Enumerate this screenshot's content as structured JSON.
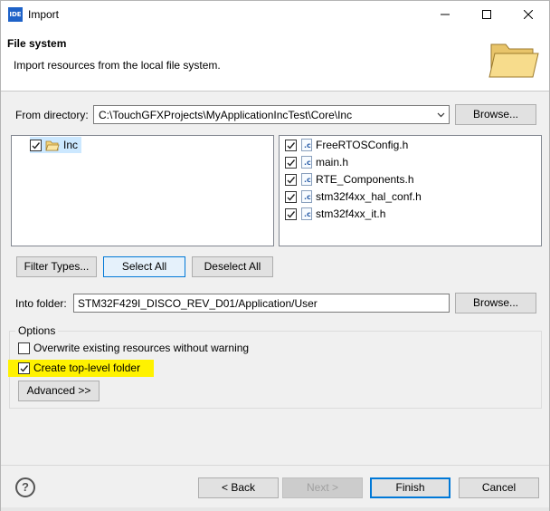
{
  "window": {
    "app_icon_text": "IDE",
    "title": "Import"
  },
  "header": {
    "title": "File system",
    "description": "Import resources from the local file system."
  },
  "from_directory": {
    "label": "From directory:",
    "value": "C:\\TouchGFXProjects\\MyApplicationIncTest\\Core\\Inc",
    "browse_label": "Browse..."
  },
  "folders": [
    {
      "label": "Inc",
      "checked": true
    }
  ],
  "files": [
    {
      "label": "FreeRTOSConfig.h",
      "checked": true,
      "icon": "c-header-icon"
    },
    {
      "label": "main.h",
      "checked": true,
      "icon": "c-header-icon"
    },
    {
      "label": "RTE_Components.h",
      "checked": true,
      "icon": "c-header-icon"
    },
    {
      "label": "stm32f4xx_hal_conf.h",
      "checked": true,
      "icon": "c-header-icon"
    },
    {
      "label": "stm32f4xx_it.h",
      "checked": true,
      "icon": "c-header-icon"
    }
  ],
  "selection_buttons": {
    "filter_types": "Filter Types...",
    "select_all": "Select All",
    "deselect_all": "Deselect All"
  },
  "into_folder": {
    "label": "Into folder:",
    "value": "STM32F429I_DISCO_REV_D01/Application/User",
    "browse_label": "Browse..."
  },
  "options": {
    "label": "Options",
    "overwrite": {
      "label": "Overwrite existing resources without warning",
      "checked": false
    },
    "create_top_level": {
      "label": "Create top-level folder",
      "checked": true,
      "highlight_color": "#fff200"
    },
    "advanced_label": "Advanced >>"
  },
  "footer": {
    "back": "< Back",
    "next": "Next >",
    "finish": "Finish",
    "cancel": "Cancel",
    "help_glyph": "?"
  },
  "colors": {
    "accent": "#0078d7",
    "highlight": "#fff200"
  }
}
